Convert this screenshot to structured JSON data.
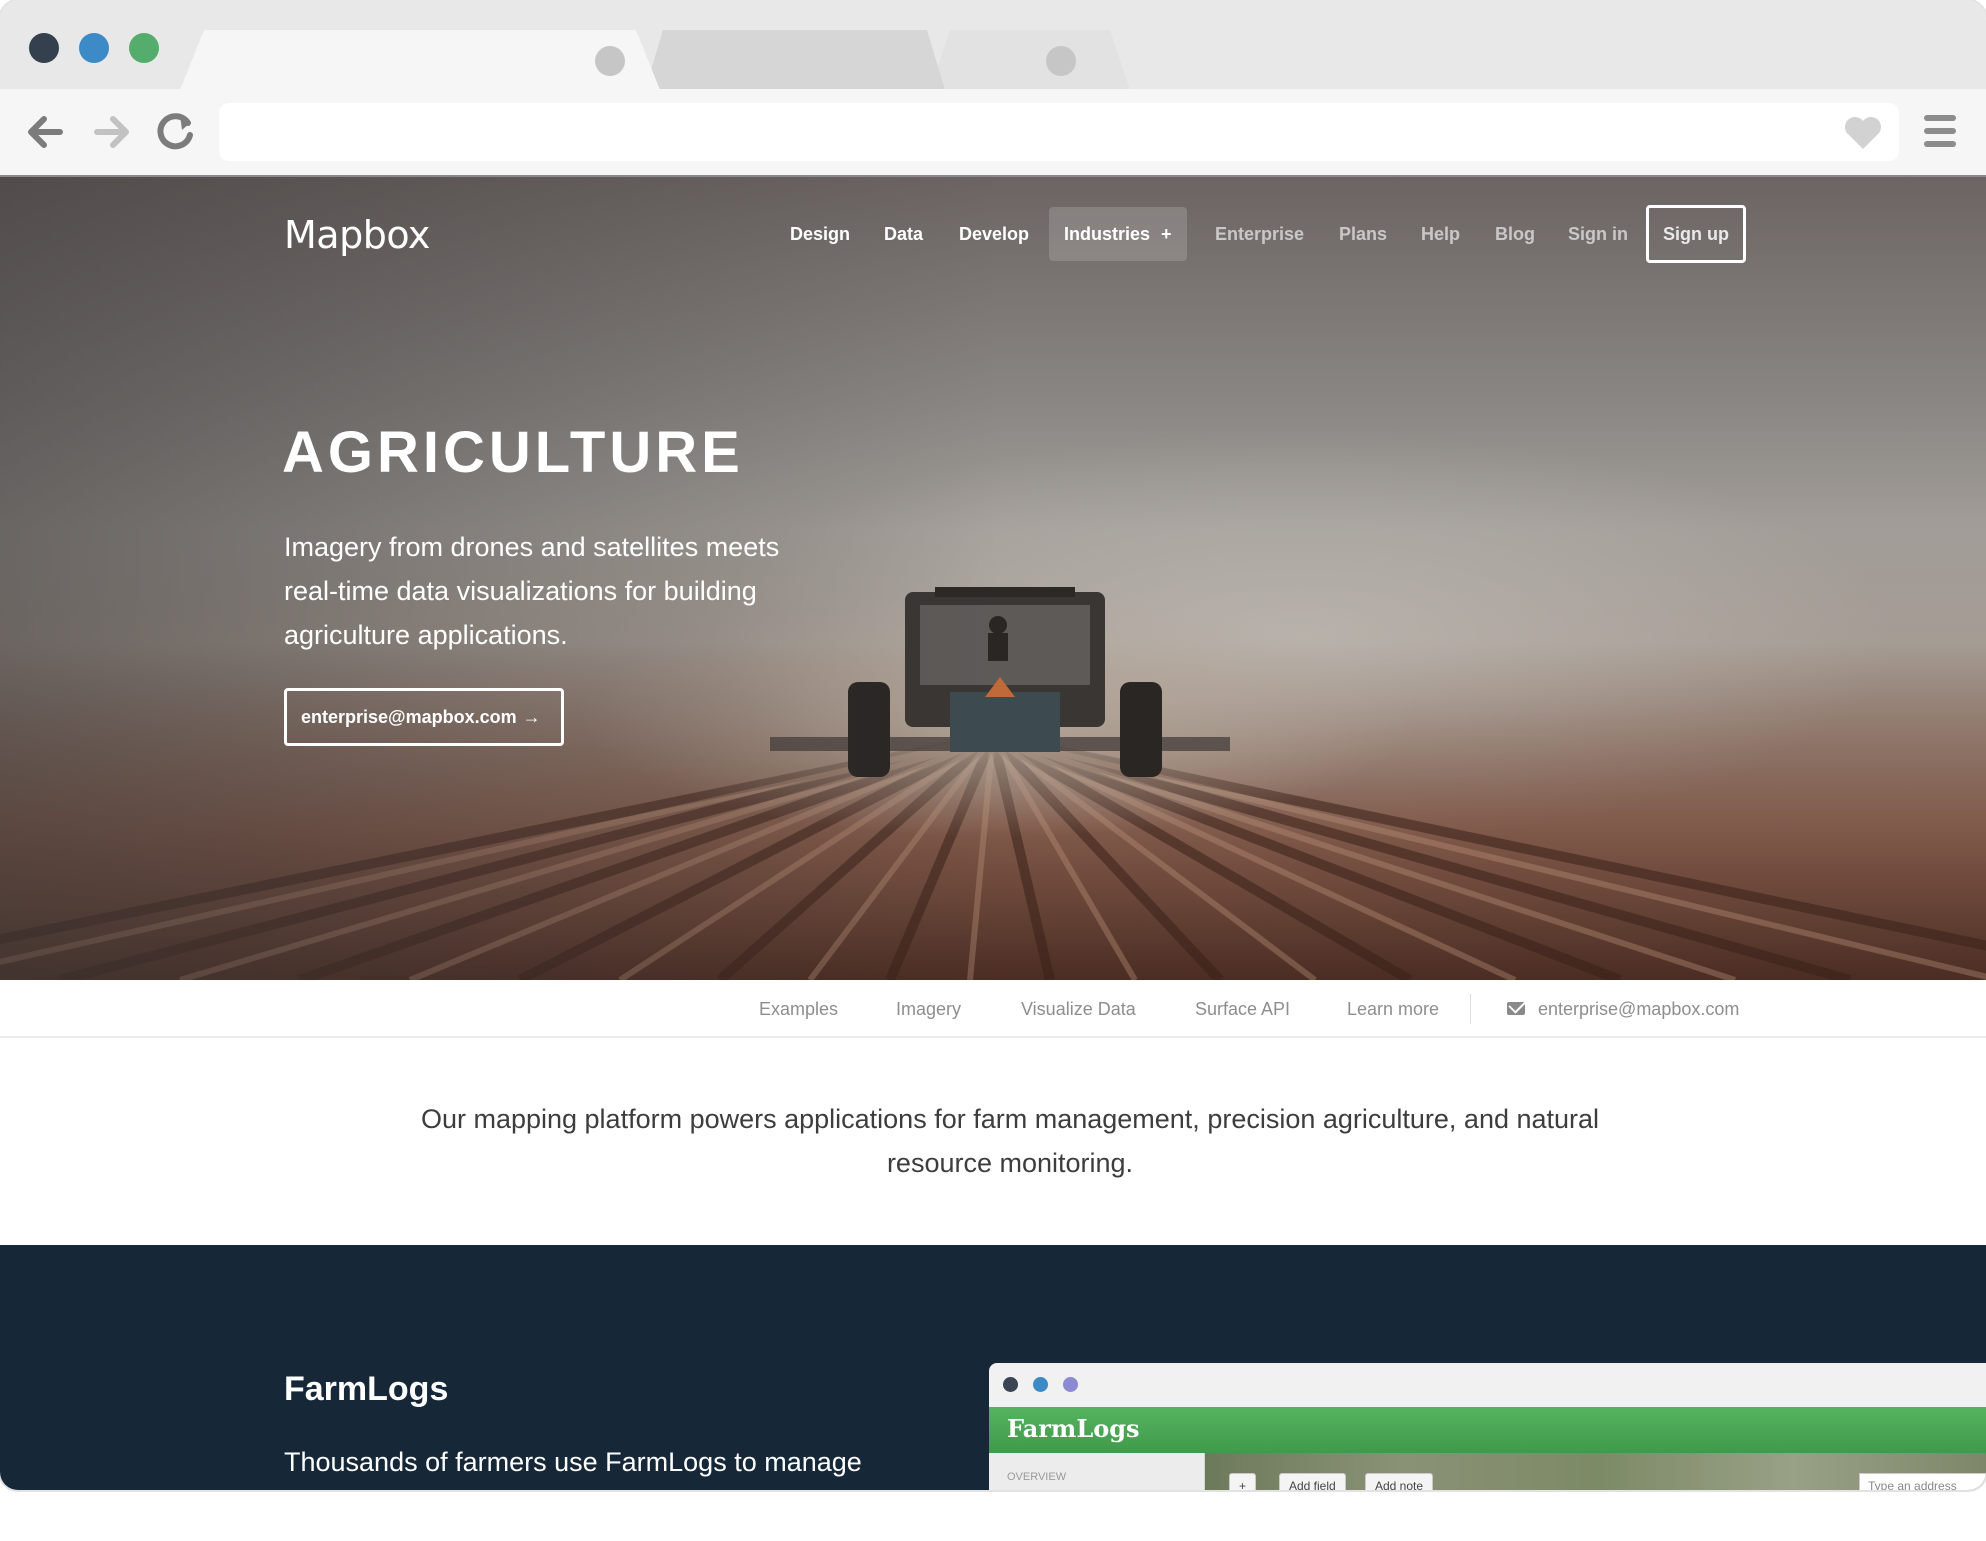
{
  "browser": {
    "back_icon": "arrow-left-icon",
    "forward_icon": "arrow-right-icon",
    "reload_icon": "reload-icon",
    "bookmark_icon": "heart-icon",
    "menu_icon": "hamburger-menu-icon",
    "address": "",
    "colors": {
      "close": "#34404e",
      "minimize": "#3c8ac6",
      "maximize": "#54ad6c"
    }
  },
  "site": {
    "logo": "Mapbox",
    "nav": [
      {
        "label": "Design",
        "state": "bright"
      },
      {
        "label": "Data",
        "state": "bright"
      },
      {
        "label": "Develop",
        "state": "bright"
      },
      {
        "label": "Industries",
        "icon": "plus-icon",
        "state": "active"
      },
      {
        "label": "Enterprise",
        "state": "dim"
      },
      {
        "label": "Plans",
        "state": "dim"
      },
      {
        "label": "Help",
        "state": "dim"
      },
      {
        "label": "Blog",
        "state": "dim"
      },
      {
        "label": "Sign in",
        "state": "dim"
      },
      {
        "label": "Sign up",
        "state": "outlined"
      }
    ]
  },
  "hero": {
    "title": "AGRICULTURE",
    "subtitle": "Imagery from drones and satellites meets real-time data visualizations for building agriculture applications.",
    "cta_label": "enterprise@mapbox.com",
    "cta_icon": "arrow-right-icon"
  },
  "subnav": {
    "items": [
      "Examples",
      "Imagery",
      "Visualize Data",
      "Surface API",
      "Learn more"
    ],
    "contact_icon": "mail-icon",
    "contact": "enterprise@mapbox.com"
  },
  "intro": {
    "text": "Our mapping platform powers applications for farm management, precision agriculture, and natural resource monitoring."
  },
  "farmlogs": {
    "title": "FarmLogs",
    "text": "Thousands of farmers use FarmLogs to manage",
    "screenshot": {
      "brand": "FarmLogs",
      "sidebar_label": "OVERVIEW",
      "buttons": [
        "+",
        "Add field",
        "Add note"
      ],
      "search_placeholder": "Type an address",
      "colors": {
        "header": "#56b35e",
        "dot1": "#3a4452",
        "dot2": "#3c8ac6",
        "dot3": "#8c8ad0"
      }
    }
  }
}
